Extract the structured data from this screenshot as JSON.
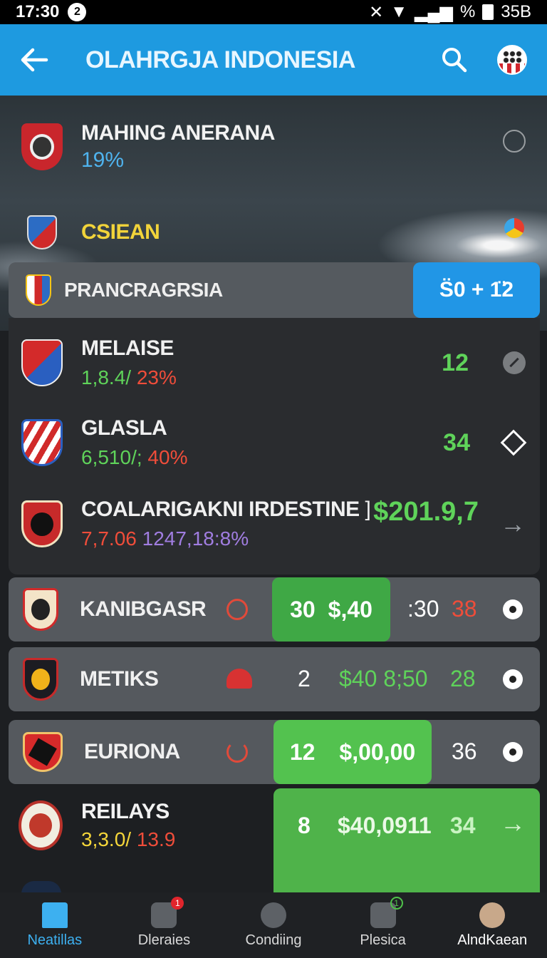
{
  "status_bar": {
    "time": "17:30",
    "notification_count": "2",
    "percent": "%",
    "battery_text": "35B"
  },
  "app_bar": {
    "title": "OLAHRGJA INDONESIA"
  },
  "hero": {
    "team1": {
      "name": "MAHING ANERANA",
      "pct": "19%"
    },
    "team2": {
      "name": "CSIEAN"
    }
  },
  "pill": {
    "label": "PRANCRAGRSIA",
    "score": "S̈0 + 1̈2"
  },
  "list": [
    {
      "name": "MELAISE",
      "sub_a": "1,8.4/",
      "sub_b": "23%",
      "value": "12"
    },
    {
      "name": "GLASLA",
      "sub_a": "6,510/;",
      "sub_b": "40%",
      "value": "34"
    },
    {
      "name": "COALARIGAKNI IRDESTINE",
      "sub_a": "7,7.06",
      "sub_b": "1247,18:8%",
      "value": "$201.9,7"
    }
  ],
  "cards": [
    {
      "name": "KANIBGASR",
      "a": "30",
      "b": "$,40",
      "c": ":30",
      "d": "38"
    },
    {
      "name": "METIKS",
      "a": "2",
      "b": "$40 8;50",
      "c": "28"
    },
    {
      "name": "EURIONA",
      "a": "12",
      "b": "$,00,00",
      "c": "36"
    },
    {
      "name": "REILAYS",
      "sub_a": "3,3.0/",
      "sub_b": "13.9",
      "a": "8",
      "b": "$40,0911",
      "c": "34"
    }
  ],
  "bottom_nav": [
    {
      "label": "Neatillas",
      "active": true
    },
    {
      "label": "Dleraies",
      "badge": "1"
    },
    {
      "label": "Condiing"
    },
    {
      "label": "Plesica",
      "badge": "1"
    },
    {
      "label": "AlndKaean"
    }
  ]
}
